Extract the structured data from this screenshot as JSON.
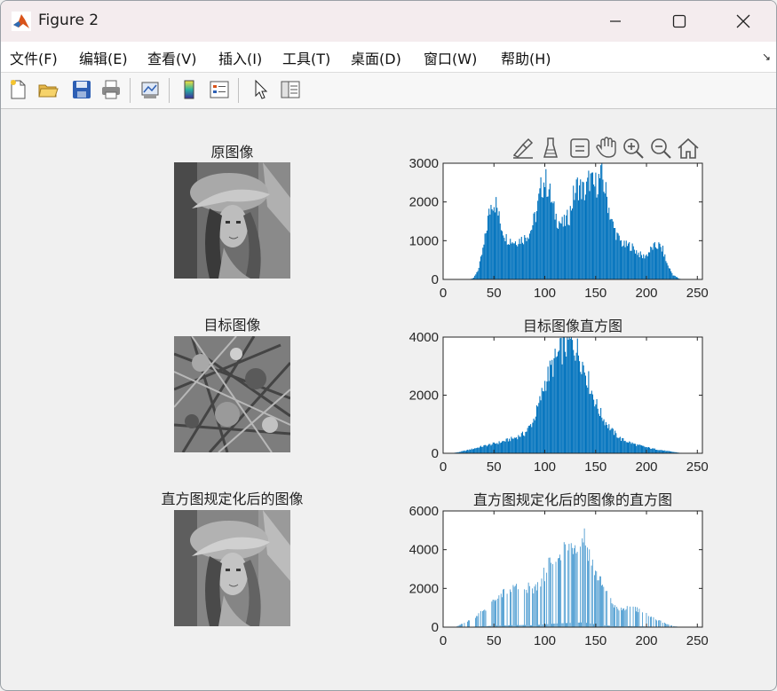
{
  "window": {
    "title": "Figure 2"
  },
  "menu": [
    "文件(F)",
    "编辑(E)",
    "查看(V)",
    "插入(I)",
    "工具(T)",
    "桌面(D)",
    "窗口(W)",
    "帮助(H)"
  ],
  "toolbar": {
    "icons": [
      "new-figure-icon",
      "open-file-icon",
      "save-icon",
      "print-icon",
      "link-plot-icon",
      "insert-colorbar-icon",
      "insert-legend-icon",
      "edit-plot-arrow-icon",
      "property-inspector-icon"
    ]
  },
  "axes_toolbar": {
    "icons": [
      "brush-data-icon",
      "data-tips-icon",
      "restore-view-icon",
      "pan-hand-icon",
      "zoom-in-icon",
      "zoom-out-icon",
      "home-icon"
    ]
  },
  "images": [
    {
      "title": "原图像",
      "kind": "portrait"
    },
    {
      "title": "目标图像",
      "kind": "foliage"
    },
    {
      "title": "直方图规定化后的图像",
      "kind": "portrait"
    }
  ],
  "colors": {
    "bar": "#0072bd",
    "axis": "#262626"
  },
  "chart_data": [
    {
      "type": "bar",
      "title": "",
      "xlabel": "",
      "ylabel": "",
      "xlim": [
        0,
        255
      ],
      "ylim": [
        0,
        3000
      ],
      "xticks": [
        0,
        50,
        100,
        150,
        200,
        250
      ],
      "yticks": [
        0,
        1000,
        2000,
        3000
      ],
      "profile": [
        [
          0,
          0
        ],
        [
          25,
          0
        ],
        [
          30,
          40
        ],
        [
          35,
          300
        ],
        [
          40,
          900
        ],
        [
          44,
          1600
        ],
        [
          48,
          2100
        ],
        [
          52,
          2000
        ],
        [
          56,
          1500
        ],
        [
          62,
          1100
        ],
        [
          70,
          1000
        ],
        [
          80,
          1100
        ],
        [
          86,
          1300
        ],
        [
          92,
          1800
        ],
        [
          96,
          2400
        ],
        [
          100,
          2650
        ],
        [
          104,
          2400
        ],
        [
          108,
          1900
        ],
        [
          112,
          1600
        ],
        [
          118,
          1450
        ],
        [
          124,
          1700
        ],
        [
          128,
          2200
        ],
        [
          132,
          2500
        ],
        [
          136,
          2400
        ],
        [
          140,
          2300
        ],
        [
          144,
          2700
        ],
        [
          148,
          2450
        ],
        [
          152,
          2600
        ],
        [
          156,
          2750
        ],
        [
          160,
          2300
        ],
        [
          166,
          1500
        ],
        [
          172,
          1100
        ],
        [
          178,
          900
        ],
        [
          184,
          900
        ],
        [
          190,
          750
        ],
        [
          196,
          600
        ],
        [
          200,
          650
        ],
        [
          206,
          850
        ],
        [
          212,
          900
        ],
        [
          216,
          780
        ],
        [
          220,
          420
        ],
        [
          226,
          120
        ],
        [
          232,
          20
        ],
        [
          236,
          0
        ],
        [
          255,
          0
        ]
      ]
    },
    {
      "type": "bar",
      "title": "目标图像直方图",
      "xlabel": "",
      "ylabel": "",
      "xlim": [
        0,
        255
      ],
      "ylim": [
        0,
        4000
      ],
      "xticks": [
        0,
        50,
        100,
        150,
        200,
        250
      ],
      "yticks": [
        0,
        2000,
        4000
      ],
      "profile": [
        [
          0,
          0
        ],
        [
          8,
          0
        ],
        [
          15,
          40
        ],
        [
          25,
          120
        ],
        [
          40,
          260
        ],
        [
          55,
          380
        ],
        [
          70,
          540
        ],
        [
          80,
          700
        ],
        [
          88,
          1100
        ],
        [
          94,
          1700
        ],
        [
          100,
          2500
        ],
        [
          106,
          3000
        ],
        [
          112,
          3400
        ],
        [
          118,
          3750
        ],
        [
          124,
          3950
        ],
        [
          128,
          3900
        ],
        [
          134,
          3500
        ],
        [
          140,
          2900
        ],
        [
          146,
          2200
        ],
        [
          152,
          1600
        ],
        [
          158,
          1200
        ],
        [
          166,
          800
        ],
        [
          175,
          500
        ],
        [
          190,
          300
        ],
        [
          205,
          170
        ],
        [
          220,
          80
        ],
        [
          232,
          20
        ],
        [
          240,
          0
        ],
        [
          255,
          0
        ]
      ]
    },
    {
      "type": "bar",
      "title": "直方图规定化后的图像的直方图",
      "xlabel": "",
      "ylabel": "",
      "xlim": [
        0,
        255
      ],
      "ylim": [
        0,
        6000
      ],
      "xticks": [
        0,
        50,
        100,
        150,
        200,
        250
      ],
      "yticks": [
        0,
        2000,
        4000,
        6000
      ],
      "profile": [
        [
          0,
          0
        ],
        [
          12,
          0
        ],
        [
          18,
          150
        ],
        [
          26,
          350
        ],
        [
          34,
          650
        ],
        [
          42,
          1000
        ],
        [
          50,
          1400
        ],
        [
          58,
          1750
        ],
        [
          66,
          2000
        ],
        [
          74,
          2150
        ],
        [
          82,
          2200
        ],
        [
          88,
          1800
        ],
        [
          92,
          2200
        ],
        [
          98,
          2700
        ],
        [
          104,
          3200
        ],
        [
          110,
          3700
        ],
        [
          116,
          4000
        ],
        [
          122,
          4300
        ],
        [
          128,
          4400
        ],
        [
          134,
          4700
        ],
        [
          138,
          5000
        ],
        [
          142,
          4300
        ],
        [
          148,
          3200
        ],
        [
          154,
          2500
        ],
        [
          160,
          1800
        ],
        [
          166,
          1300
        ],
        [
          172,
          900
        ],
        [
          180,
          1000
        ],
        [
          188,
          1050
        ],
        [
          196,
          800
        ],
        [
          204,
          600
        ],
        [
          212,
          350
        ],
        [
          220,
          160
        ],
        [
          228,
          40
        ],
        [
          234,
          0
        ],
        [
          255,
          0
        ]
      ]
    }
  ]
}
